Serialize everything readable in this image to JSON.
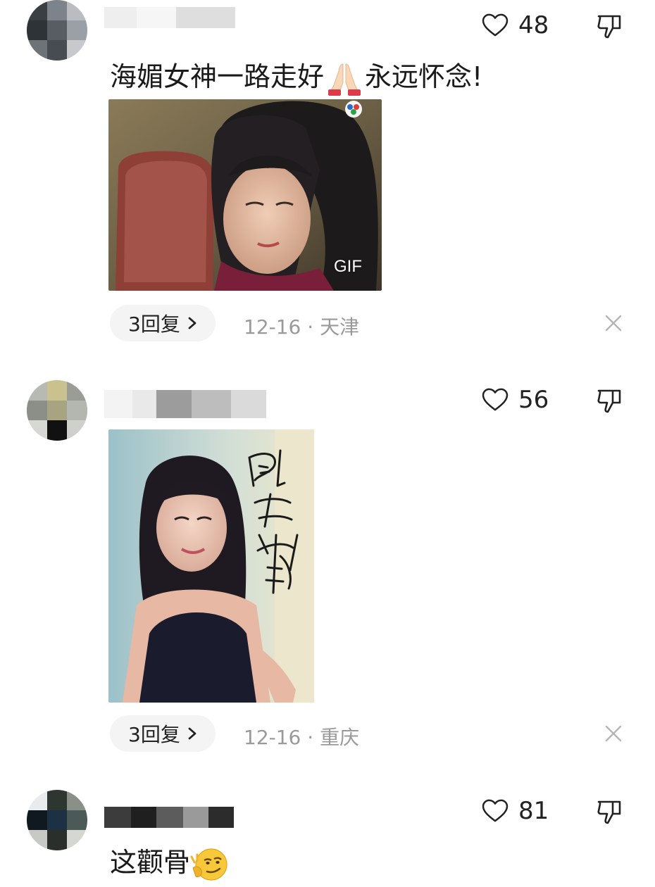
{
  "comments": [
    {
      "likes": "48",
      "text_before": "海媚女神一路走好",
      "emoji": "folded-hands",
      "text_after": "永远怀念!",
      "media": {
        "type": "gif",
        "badge": "GIF"
      },
      "reply_label": "3回复",
      "date": "12-16",
      "separator": "·",
      "location": "天津"
    },
    {
      "likes": "56",
      "media": {
        "type": "photo"
      },
      "reply_label": "3回复",
      "date": "12-16",
      "separator": "·",
      "location": "重庆"
    },
    {
      "likes": "81",
      "text_before": "这颧骨",
      "emoji": "thinking-smirk-face"
    }
  ],
  "icons": {
    "like": "heart-outline-icon",
    "dislike": "thumbs-down-icon",
    "reply_chevron": "chevron-right-icon",
    "close": "close-icon"
  },
  "colors": {
    "text": "#1a1a1a",
    "meta": "#9a9a9a",
    "pill_bg": "#f4f4f4"
  }
}
